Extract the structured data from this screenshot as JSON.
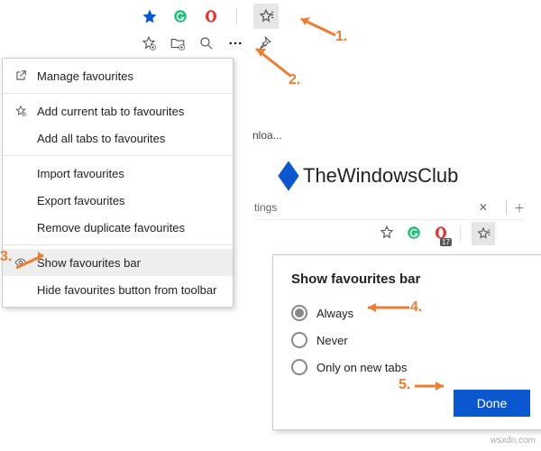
{
  "toolbar_icons": [
    "star-filled-icon",
    "grammarly-icon",
    "opera-icon",
    "favorites-icon"
  ],
  "menu": {
    "items": [
      {
        "icon": "external-link-icon",
        "label": "Manage favourites"
      },
      {
        "icon": "star-add-icon",
        "label": "Add current tab to favourites"
      },
      {
        "icon": "",
        "label": "Add all tabs to favourites"
      },
      {
        "icon": "",
        "label": "Import favourites"
      },
      {
        "icon": "",
        "label": "Export favourites"
      },
      {
        "icon": "",
        "label": "Remove duplicate favourites"
      },
      {
        "icon": "eye-icon",
        "label": "Show favourites bar"
      },
      {
        "icon": "",
        "label": "Hide favourites button from toolbar"
      }
    ]
  },
  "middle_fragment": "nloa...",
  "brand": "TheWindowsClub",
  "tab_fragment": "tings",
  "toolbar3_badge": "17",
  "panel": {
    "title": "Show favourites bar",
    "options": [
      "Always",
      "Never",
      "Only on new tabs"
    ],
    "selected": 0,
    "done": "Done"
  },
  "callouts": {
    "n1": "1.",
    "n2": "2.",
    "n3": "3.",
    "n4": "4.",
    "n5": "5."
  },
  "watermark": "wsxdn.com",
  "colors": {
    "accent": "#ed7d31",
    "primary": "#0b57d0"
  }
}
